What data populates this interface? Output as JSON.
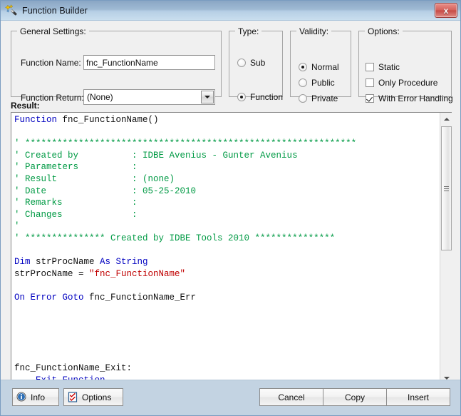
{
  "window": {
    "title": "Function Builder",
    "icon": "magic-wand-icon",
    "close_label": "x"
  },
  "general_settings": {
    "legend": "General Settings:",
    "function_name_label": "Function Name:",
    "function_name_value": "fnc_FunctionName",
    "function_name_placeholder": "",
    "function_return_label": "Function Return:",
    "function_return_value": "(None)",
    "function_return_options": [
      "(None)"
    ]
  },
  "type_group": {
    "legend": "Type:",
    "options": [
      {
        "label": "Sub",
        "checked": false
      },
      {
        "label": "Function",
        "checked": true
      }
    ]
  },
  "validity_group": {
    "legend": "Validity:",
    "options": [
      {
        "label": "Normal",
        "checked": true
      },
      {
        "label": "Public",
        "checked": false
      },
      {
        "label": "Private",
        "checked": false
      }
    ]
  },
  "options_group": {
    "legend": "Options:",
    "options": [
      {
        "label": "Static",
        "checked": false
      },
      {
        "label": "Only Procedure",
        "checked": false
      },
      {
        "label": "With Error Handling",
        "checked": true
      }
    ]
  },
  "result": {
    "label": "Result:",
    "code_lines": [
      [
        {
          "t": "Function",
          "c": "kw"
        },
        {
          "t": " fnc_FunctionName()",
          "c": ""
        }
      ],
      [
        {
          "t": "",
          "c": ""
        }
      ],
      [
        {
          "t": "' **************************************************************",
          "c": "cm"
        }
      ],
      [
        {
          "t": "' Created by          : IDBE Avenius - Gunter Avenius",
          "c": "cm"
        }
      ],
      [
        {
          "t": "' Parameters          :",
          "c": "cm"
        }
      ],
      [
        {
          "t": "' Result              : (none)",
          "c": "cm"
        }
      ],
      [
        {
          "t": "' Date                : 05-25-2010",
          "c": "cm"
        }
      ],
      [
        {
          "t": "' Remarks             :",
          "c": "cm"
        }
      ],
      [
        {
          "t": "' Changes             :",
          "c": "cm"
        }
      ],
      [
        {
          "t": "'",
          "c": "cm"
        }
      ],
      [
        {
          "t": "' *************** Created by IDBE Tools 2010 ***************",
          "c": "cm"
        }
      ],
      [
        {
          "t": "",
          "c": ""
        }
      ],
      [
        {
          "t": "Dim",
          "c": "kw"
        },
        {
          "t": " strProcName ",
          "c": ""
        },
        {
          "t": "As String",
          "c": "kw"
        }
      ],
      [
        {
          "t": "strProcName = ",
          "c": ""
        },
        {
          "t": "\"fnc_FunctionName\"",
          "c": "st"
        }
      ],
      [
        {
          "t": "",
          "c": ""
        }
      ],
      [
        {
          "t": "On Error Goto",
          "c": "kw"
        },
        {
          "t": " fnc_FunctionName_Err",
          "c": ""
        }
      ],
      [
        {
          "t": "",
          "c": ""
        }
      ],
      [
        {
          "t": "",
          "c": ""
        }
      ],
      [
        {
          "t": "",
          "c": ""
        }
      ],
      [
        {
          "t": "",
          "c": ""
        }
      ],
      [
        {
          "t": "",
          "c": ""
        }
      ],
      [
        {
          "t": "fnc_FunctionName_Exit:",
          "c": ""
        }
      ],
      [
        {
          "t": "    ",
          "c": ""
        },
        {
          "t": "Exit Function",
          "c": "kw"
        }
      ]
    ],
    "scrollbar": {
      "up_icon": "scroll-up-icon",
      "down_icon": "scroll-down-icon"
    }
  },
  "buttons": {
    "info": {
      "label": "Info",
      "icon": "info-icon"
    },
    "options": {
      "label": "Options",
      "icon": "checklist-icon"
    },
    "cancel": {
      "label": "Cancel"
    },
    "copy": {
      "label": "Copy"
    },
    "insert": {
      "label": "Insert"
    }
  },
  "colors": {
    "titlebar_top": "#8aa6c4",
    "titlebar_bottom": "#c9deee",
    "bottombar": "#c3d3e2",
    "dialog_face": "#f0f0f0",
    "keyword": "#0000c0",
    "comment": "#009a44",
    "string": "#c00000",
    "close_button": "#c64a45"
  }
}
